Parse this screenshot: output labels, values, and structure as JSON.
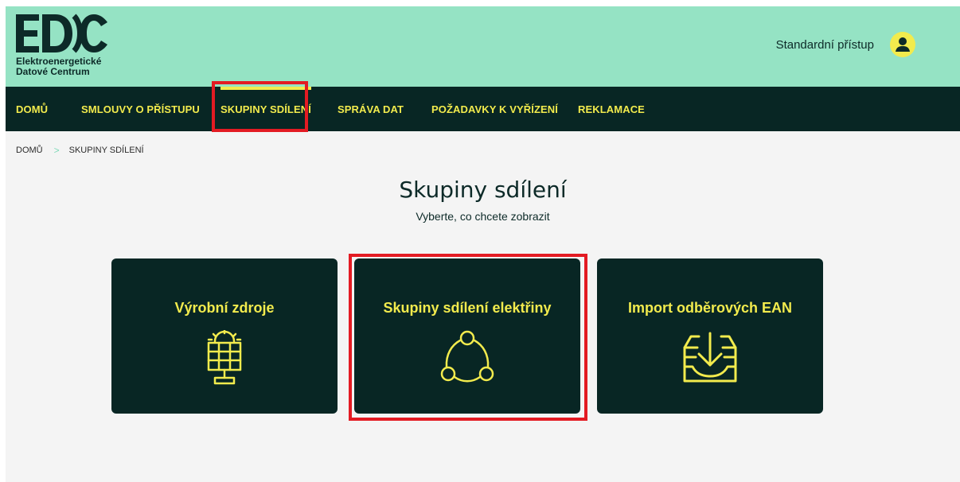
{
  "brand": {
    "line1": "Elektroenergetické",
    "line2": "Datové Centrum"
  },
  "user": {
    "access_label": "Standardní přístup"
  },
  "nav": {
    "items": [
      {
        "label": "DOMŮ"
      },
      {
        "label": "SMLOUVY O PŘÍSTUPU"
      },
      {
        "label": "SKUPINY SDÍLENÍ"
      },
      {
        "label": "SPRÁVA DAT"
      },
      {
        "label": "POŽADAVKY K VYŘÍZENÍ"
      },
      {
        "label": "REKLAMACE"
      }
    ],
    "active": "SKUPINY SDÍLENÍ"
  },
  "breadcrumb": {
    "items": [
      "DOMŮ",
      "SKUPINY SDÍLENÍ"
    ],
    "separator": ">"
  },
  "main": {
    "title": "Skupiny sdílení",
    "subtitle": "Vyberte, co chcete zobrazit",
    "cards": [
      {
        "title": "Výrobní zdroje",
        "icon": "solar-panel-icon"
      },
      {
        "title": "Skupiny sdílení elektřiny",
        "icon": "sharing-group-icon"
      },
      {
        "title": "Import odběrových EAN",
        "icon": "import-tray-icon"
      }
    ]
  },
  "colors": {
    "header_bg": "#95e3c4",
    "nav_bg": "#082624",
    "accent": "#f2eb4d",
    "highlight": "#e31b23",
    "page_bg": "#f4f4f4"
  }
}
